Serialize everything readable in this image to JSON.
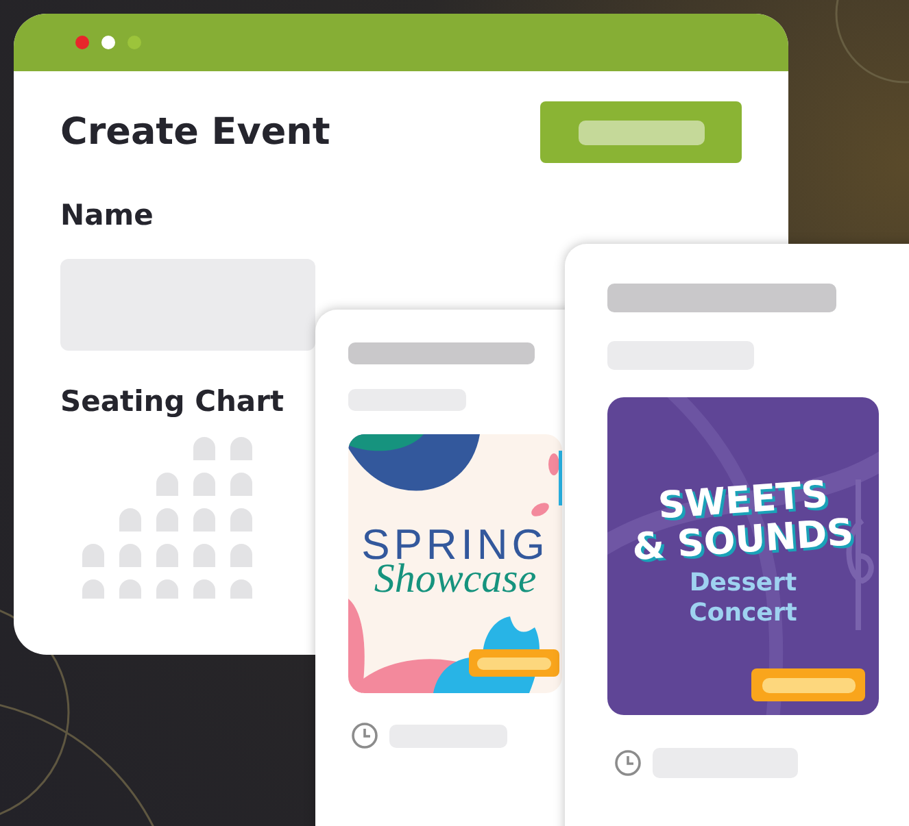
{
  "window": {
    "title": "Create Event",
    "controls": [
      {
        "color": "#e8262b"
      },
      {
        "color": "#ffffff"
      },
      {
        "color": "#9cc43b"
      }
    ]
  },
  "form": {
    "fields": [
      {
        "label": "Name",
        "kind": "text"
      },
      {
        "label": "Seating Chart",
        "kind": "seats"
      }
    ]
  },
  "cards": [
    {
      "kind": "floral",
      "poster_title": [
        "SPRING"
      ],
      "poster_subtitle": "Showcase"
    },
    {
      "kind": "music",
      "poster_title": [
        "SWEETS",
        "& SOUNDS"
      ],
      "poster_subtitle": "Dessert Concert"
    }
  ]
}
